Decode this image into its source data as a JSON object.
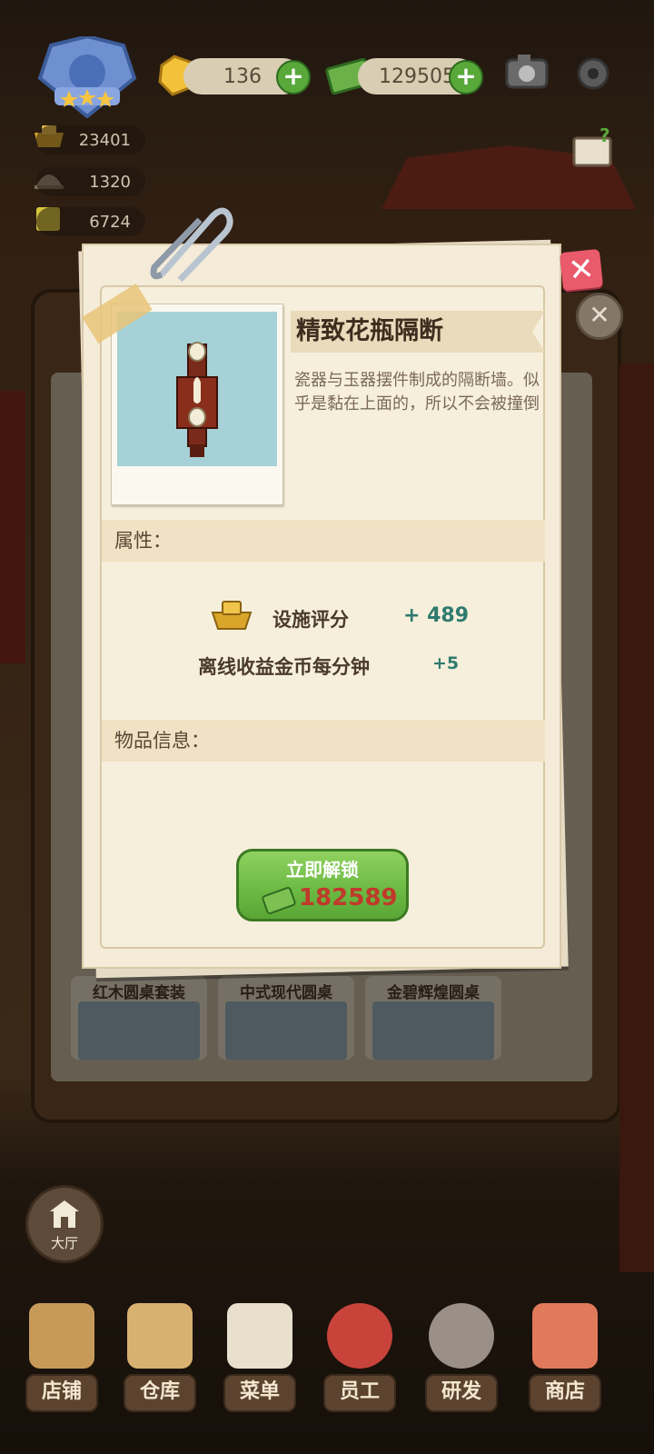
{
  "hud": {
    "gems": "136",
    "cash": "129505",
    "stats": [
      "23401",
      "1320",
      "6724"
    ]
  },
  "background_categories": [
    "红木圆桌套装",
    "中式现代圆桌",
    "金碧辉煌圆桌"
  ],
  "modal": {
    "item_name": "精致花瓶隔断",
    "description": "瓷器与玉器摆件制成的隔断墙。似乎是黏在上面的，所以不会被撞倒",
    "attributes_heading": "属性：",
    "attributes": [
      {
        "label": "设施评分",
        "value": "+ 489",
        "icon": "gold-ingot-icon"
      },
      {
        "label": "离线收益金币每分钟",
        "value": "+5"
      }
    ],
    "item_info_heading": "物品信息：",
    "unlock_button": {
      "label": "立即解锁",
      "price": "182589",
      "icon": "cash-stack-icon"
    }
  },
  "lobby_button": "大厅",
  "nav": [
    "店铺",
    "仓库",
    "菜单",
    "员工",
    "研发",
    "商店"
  ],
  "colors": {
    "accent_green": "#6dbb44",
    "price_red": "#c0392b",
    "value_teal": "#2f7a6e",
    "close_red": "#e95a6a"
  }
}
